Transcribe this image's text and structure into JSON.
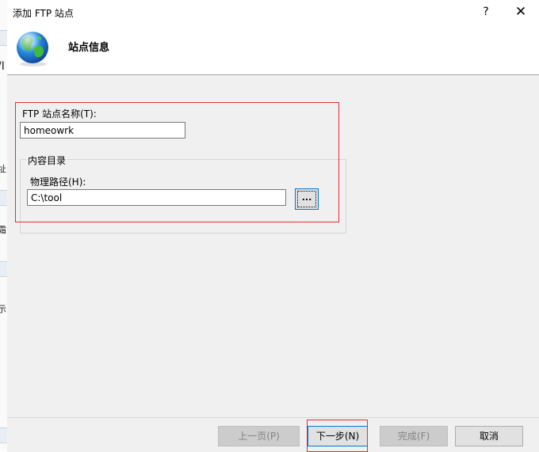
{
  "dialog": {
    "title": "添加 FTP 站点",
    "help_label": "?",
    "close_label": "✕"
  },
  "header": {
    "page_title": "站点信息",
    "icon": "globe-icon"
  },
  "form": {
    "site_name_label": "FTP 站点名称(T):",
    "site_name_value": "homeowrk",
    "content_dir_label": "内容目录",
    "physical_path_label": "物理路径(H):",
    "physical_path_value": "C:\\tool",
    "browse_label": "..."
  },
  "footer": {
    "prev_label": "上一页(P)",
    "next_label": "下一步(N)",
    "finish_label": "完成(F)",
    "cancel_label": "取消"
  },
  "background_window": {
    "fragments": [
      "/I",
      "址",
      "霜",
      "示"
    ]
  },
  "colors": {
    "highlight": "#e03030",
    "focus_border": "#0078d7",
    "dialog_bg": "#f0f0f0"
  }
}
